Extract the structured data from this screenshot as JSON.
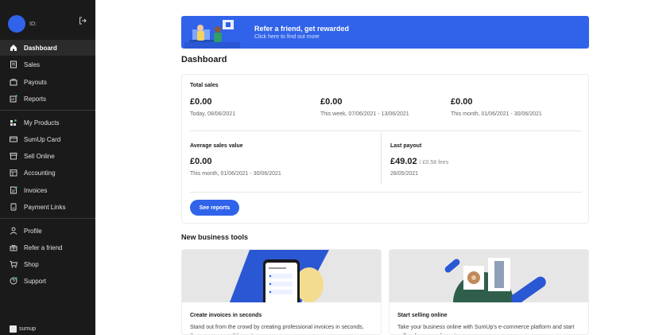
{
  "sidebar": {
    "user_id": "ID:",
    "nav_main": [
      {
        "label": "Dashboard",
        "icon": "home-icon",
        "active": true
      },
      {
        "label": "Sales",
        "icon": "sales-icon"
      },
      {
        "label": "Payouts",
        "icon": "payouts-icon"
      },
      {
        "label": "Reports",
        "icon": "reports-icon"
      }
    ],
    "nav_products": [
      {
        "label": "My Products",
        "icon": "products-icon"
      },
      {
        "label": "SumUp Card",
        "icon": "card-icon"
      },
      {
        "label": "Sell Online",
        "icon": "store-icon"
      },
      {
        "label": "Accounting",
        "icon": "accounting-icon"
      },
      {
        "label": "Invoices",
        "icon": "invoice-icon"
      },
      {
        "label": "Payment Links",
        "icon": "payment-link-icon"
      }
    ],
    "nav_account": [
      {
        "label": "Profile",
        "icon": "profile-icon"
      },
      {
        "label": "Refer a friend",
        "icon": "gift-icon"
      },
      {
        "label": "Shop",
        "icon": "cart-icon"
      },
      {
        "label": "Support",
        "icon": "support-icon"
      }
    ],
    "brand": "sumup"
  },
  "banner": {
    "title": "Refer a friend, get rewarded",
    "subtitle": "Click here to find out more"
  },
  "page_title": "Dashboard",
  "total_sales": {
    "label": "Total sales",
    "periods": [
      {
        "value": "£0.00",
        "caption": "Today, 08/06/2021"
      },
      {
        "value": "£0.00",
        "caption": "This week, 07/06/2021 - 13/06/2021"
      },
      {
        "value": "£0.00",
        "caption": "This month, 01/06/2021 - 30/06/2021"
      }
    ]
  },
  "avg_sales": {
    "label": "Average sales value",
    "value": "£0.00",
    "caption": "This month, 01/06/2021 - 30/06/2021"
  },
  "last_payout": {
    "label": "Last payout",
    "value": "£49.02",
    "fees": "/ £0.58 fees",
    "date": "28/05/2021"
  },
  "see_reports": "See reports",
  "business_tools": {
    "title": "New business tools",
    "tools": [
      {
        "title": "Create invoices in seconds",
        "desc": "Stand out from the crowd by creating professional invoices in seconds, there are no monthly cost."
      },
      {
        "title": "Start selling online",
        "desc": "Take your business online with SumUp's e-commerce platform and start selling from anywhere, to anyone."
      }
    ]
  },
  "colors": {
    "accent": "#3063e9",
    "sidebar": "#1a1a1a"
  }
}
